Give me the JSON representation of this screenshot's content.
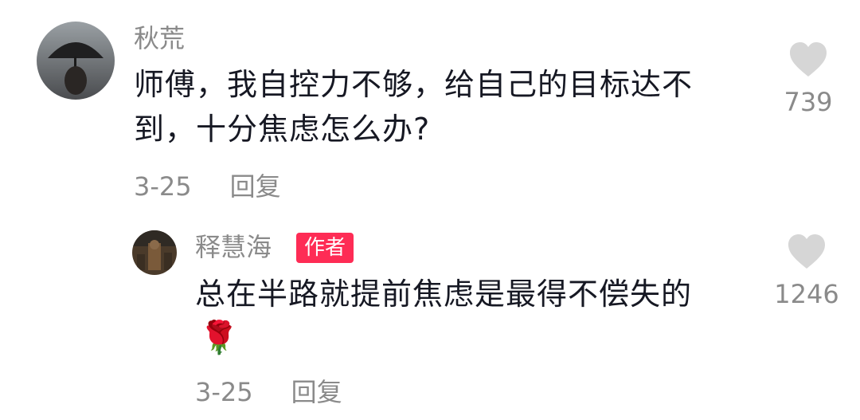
{
  "comment": {
    "username": "秋荒",
    "text": "师傅，我自控力不够，给自己的目标达不到，十分焦虑怎么办?",
    "date": "3-25",
    "reply_label": "回复",
    "likes": "739"
  },
  "reply": {
    "username": "释慧海",
    "badge": "作者",
    "text": "总在半路就提前焦虑是最得不偿失的",
    "emoji": "🌹",
    "date": "3-25",
    "reply_label": "回复",
    "likes": "1246"
  },
  "icons": {
    "like": "heart-icon",
    "emoji": "rose-icon"
  },
  "colors": {
    "badge": "#fe2c55",
    "muted": "#8a8a8a",
    "text": "#161823",
    "heart": "#d6d6d6"
  }
}
